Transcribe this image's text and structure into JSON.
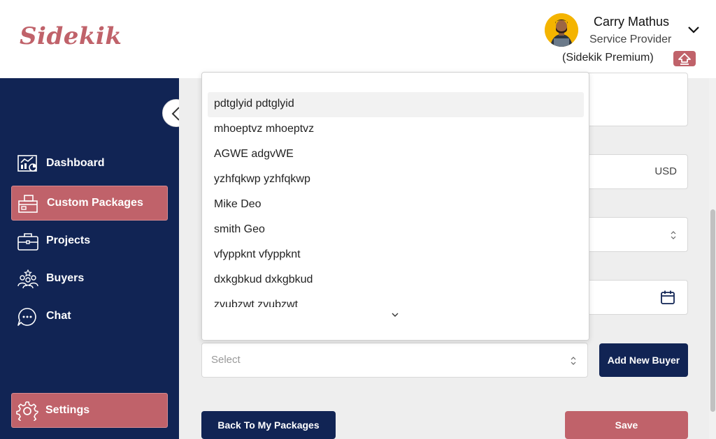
{
  "brand": {
    "logo_text": "Sidekik",
    "color": "#c0626a"
  },
  "user": {
    "name": "Carry Mathus",
    "role": "Service Provider",
    "plan": "(Sidekik Premium)"
  },
  "sidebar": {
    "items": [
      {
        "label": "Dashboard",
        "icon": "dashboard-icon",
        "active": false
      },
      {
        "label": "Custom Packages",
        "icon": "package-icon",
        "active": true
      },
      {
        "label": "Projects",
        "icon": "briefcase-icon",
        "active": false
      },
      {
        "label": "Buyers",
        "icon": "buyers-icon",
        "active": false
      },
      {
        "label": "Chat",
        "icon": "chat-icon",
        "active": false
      }
    ],
    "settings_label": "Settings"
  },
  "form": {
    "price_currency": "USD",
    "buyer_select_placeholder": "Select",
    "add_buyer_label": "Add New Buyer",
    "back_label": "Back To My Packages",
    "save_label": "Save"
  },
  "dropdown": {
    "options": [
      "pdtglyid pdtglyid",
      "mhoeptvz mhoeptvz",
      "AGWE adgvWE",
      "yzhfqkwp yzhfqkwp",
      "Mike Deo",
      "smith Geo",
      "vfyppknt vfyppknt",
      "dxkgbkud dxkgbkud",
      "zvubzwt zvubzwt"
    ],
    "highlighted_index": 0
  },
  "colors": {
    "navy": "#112454",
    "rose": "#c0626a",
    "background": "#eeeeee"
  }
}
